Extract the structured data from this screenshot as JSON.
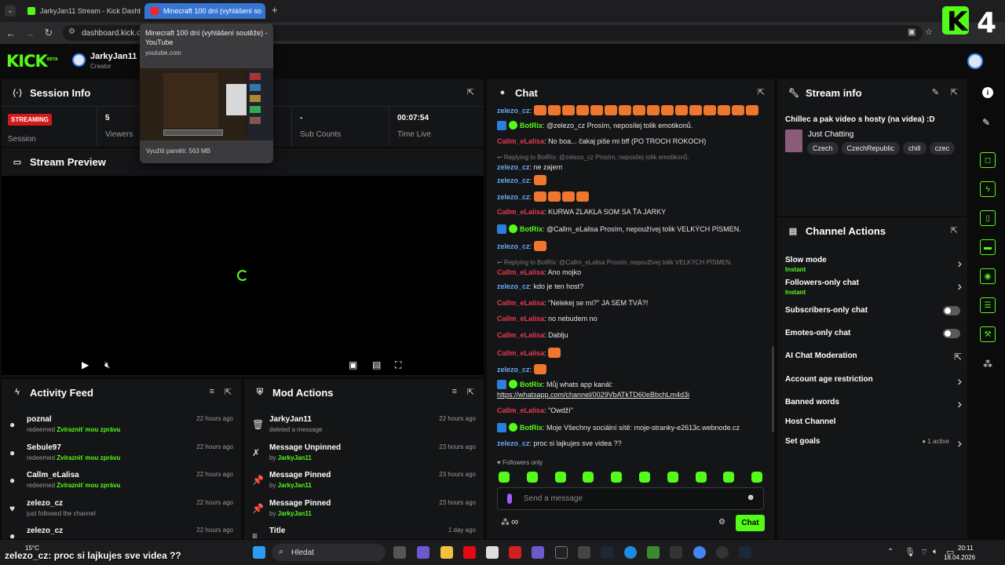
{
  "browser": {
    "tabs": [
      {
        "title": "JarkyJan11 Stream - Kick Dashb",
        "active": false
      },
      {
        "title": "Minecraft 100 dní (vyhlášení so",
        "active": true
      }
    ],
    "new_tab": "+",
    "url": "dashboard.kick.co",
    "preview": {
      "title": "Minecraft 100 dní (vyhlášení soutěže) - YouTube",
      "site": "youtube.com",
      "memory": "Využití paměti: 563 MB"
    }
  },
  "header": {
    "logo": "KICK",
    "logo_sup": "BETA",
    "username": "JarkyJan11",
    "role": "Creator"
  },
  "session": {
    "title": "Session Info",
    "status": "STREAMING",
    "status_label": "Session",
    "viewers_value": "5",
    "viewers_label": "Viewers",
    "subs_value": "-",
    "subs_label": "Sub Counts",
    "time_value": "00:07:54",
    "time_label": "Time Live"
  },
  "preview_panel": {
    "title": "Stream Preview"
  },
  "activity": {
    "title": "Activity Feed",
    "items": [
      {
        "name": "poznal",
        "sub": "redeemed ",
        "reward": "Zvírazniť mou zprávu",
        "time": "22 hours ago",
        "icon": "●"
      },
      {
        "name": "Sebule97",
        "sub": "redeemed ",
        "reward": "Zvírazniť mou zprávu",
        "time": "22 hours ago",
        "icon": "●"
      },
      {
        "name": "Callm_eLalisa",
        "sub": "redeemed ",
        "reward": "Zvírazniť mou zprávu",
        "time": "22 hours ago",
        "icon": "●"
      },
      {
        "name": "zelezo_cz",
        "sub": "just followed the channel",
        "reward": "",
        "time": "22 hours ago",
        "icon": "♥"
      },
      {
        "name": "zelezo_cz",
        "sub": "",
        "reward": "",
        "time": "22 hours ago",
        "icon": "●"
      }
    ]
  },
  "mod": {
    "title": "Mod Actions",
    "items": [
      {
        "name": "JarkyJan11",
        "sub": "deleted a message",
        "by": "",
        "time": "22 hours ago",
        "icon": "🗑"
      },
      {
        "name": "Message Unpinned",
        "sub": "by ",
        "by": "JarkyJan11",
        "time": "23 hours ago",
        "icon": "✗"
      },
      {
        "name": "Message Pinned",
        "sub": "by ",
        "by": "JarkyJan11",
        "time": "23 hours ago",
        "icon": "📌"
      },
      {
        "name": "Message Pinned",
        "sub": "by ",
        "by": "JarkyJan11",
        "time": "23 hours ago",
        "icon": "📌"
      },
      {
        "name": "Title",
        "sub": "",
        "by": "",
        "time": "1 day ago",
        "icon": "≡"
      }
    ]
  },
  "chat": {
    "title": "Chat",
    "messages": [
      {
        "user": "zelezo_cz",
        "cls": "u-zel",
        "text": "",
        "emotes": 16,
        "bot": false,
        "reply": ""
      },
      {
        "user": "BotRix",
        "cls": "u-bot",
        "text": "@zelezo_cz Prosím, neposílej tolik emotikonů.",
        "emotes": 0,
        "bot": true,
        "reply": ""
      },
      {
        "user": "Callm_eLalisa",
        "cls": "u-cal",
        "text": "No boa... čakaj piše mi bff (PO TROCH ROKOCH)",
        "emotes": 0,
        "bot": false,
        "reply": ""
      },
      {
        "user": "zelezo_cz",
        "cls": "u-zel",
        "text": "ne zajem",
        "emotes": 0,
        "bot": false,
        "reply": "Replying to BotRix: @zelezo_cz Prosím, neposílej tolik emotikonů."
      },
      {
        "user": "zelezo_cz",
        "cls": "u-zel",
        "text": "",
        "emotes": 1,
        "bot": false,
        "reply": ""
      },
      {
        "user": "zelezo_cz",
        "cls": "u-zel",
        "text": "",
        "emotes": 4,
        "bot": false,
        "reply": ""
      },
      {
        "user": "Callm_eLalisa",
        "cls": "u-cal",
        "text": "KURWA ZLAKLA SOM SA ŤA JARKY",
        "emotes": 0,
        "bot": false,
        "reply": ""
      },
      {
        "user": "BotRix",
        "cls": "u-bot",
        "text": "@Callm_eLalisa Prosím, nepoužívej tolik VELKÝCH PÍSMEN.",
        "emotes": 0,
        "bot": true,
        "reply": ""
      },
      {
        "user": "zelezo_cz",
        "cls": "u-zel",
        "text": "",
        "emotes": 1,
        "bot": false,
        "reply": ""
      },
      {
        "user": "Callm_eLalisa",
        "cls": "u-cal",
        "text": "Ano mojko",
        "emotes": 0,
        "bot": false,
        "reply": "Replying to BotRix: @Callm_eLalisa Prosím, nepoužívej tolik VELKÝCH PÍSMEN."
      },
      {
        "user": "zelezo_cz",
        "cls": "u-zel",
        "text": "kdo je ten host?",
        "emotes": 0,
        "bot": false,
        "reply": ""
      },
      {
        "user": "Callm_eLalisa",
        "cls": "u-cal",
        "text": "\"Nelekej se mi?\" JA SEM TVÁ?!",
        "emotes": 0,
        "bot": false,
        "reply": ""
      },
      {
        "user": "Callm_eLalisa",
        "cls": "u-cal",
        "text": "no nebudem no",
        "emotes": 0,
        "bot": false,
        "reply": ""
      },
      {
        "user": "Callm_eLalisa",
        "cls": "u-cal",
        "text": "Dablju",
        "emotes": 0,
        "bot": false,
        "reply": ""
      },
      {
        "user": "Callm_eLalisa",
        "cls": "u-cal",
        "text": "",
        "emotes": 1,
        "bot": false,
        "reply": ""
      },
      {
        "user": "zelezo_cz",
        "cls": "u-zel",
        "text": "",
        "emotes": 1,
        "bot": false,
        "reply": ""
      },
      {
        "user": "BotRix",
        "cls": "u-bot",
        "text": "Můj whats app kanál:",
        "emotes": 0,
        "bot": true,
        "reply": ""
      },
      {
        "user": "",
        "cls": "u-bot",
        "text": "https://whatsapp.com/channel/0029VbATkTD60eBbchLm4d3i",
        "emotes": 0,
        "bot": false,
        "reply": "",
        "link": true
      },
      {
        "user": "Callm_eLalisa",
        "cls": "u-cal",
        "text": "\"Owdží\"",
        "emotes": 0,
        "bot": false,
        "reply": ""
      },
      {
        "user": "BotRix",
        "cls": "u-bot",
        "text": "Moje Všechny sociální sítě: moje-stranky-e2613c.webnode.cz",
        "emotes": 0,
        "bot": true,
        "reply": ""
      },
      {
        "user": "zelezo_cz",
        "cls": "u-zel",
        "text": "proc si lajkujes sve videa ??",
        "emotes": 0,
        "bot": false,
        "reply": ""
      }
    ],
    "followers_only": "Followers only",
    "input_placeholder": "Send a message",
    "chat_button": "Chat",
    "infinity": "∞"
  },
  "stream_info": {
    "title": "Stream info",
    "stream_title": "Chillec a pak video s hosty (na videa) :D",
    "category": "Just Chatting",
    "tags": [
      "Czech",
      "CzechRepublic",
      "chill",
      "czec"
    ]
  },
  "channel_actions": {
    "title": "Channel Actions",
    "items": [
      {
        "label": "Slow mode",
        "sub": "Instant",
        "ctrl": "chevron"
      },
      {
        "label": "Followers-only chat",
        "sub": "Instant",
        "ctrl": "chevron"
      },
      {
        "label": "Subscribers-only chat",
        "sub": "",
        "ctrl": "toggle"
      },
      {
        "label": "Emotes-only chat",
        "sub": "",
        "ctrl": "toggle"
      },
      {
        "label": "AI Chat Moderation",
        "sub": "",
        "ctrl": "external"
      },
      {
        "label": "Account age restriction",
        "sub": "",
        "ctrl": "chevron"
      },
      {
        "label": "Banned words",
        "sub": "",
        "ctrl": "chevron"
      },
      {
        "label": "Host Channel",
        "sub": "",
        "ctrl": "none"
      },
      {
        "label": "Set goals",
        "sub": "",
        "ctrl": "chevron",
        "badge": "1 active"
      }
    ]
  },
  "taskbar": {
    "weather": "15°C",
    "search": "Hledat",
    "time": "20:11",
    "date": "18.04.2026",
    "overlay_chat": "zelezo_cz: proc si lajkujes sve videa ??"
  },
  "colors": {
    "accent": "#53fc18",
    "live": "#d4191a",
    "zelezo": "#6aa9f5",
    "lalisa": "#e63a55"
  }
}
